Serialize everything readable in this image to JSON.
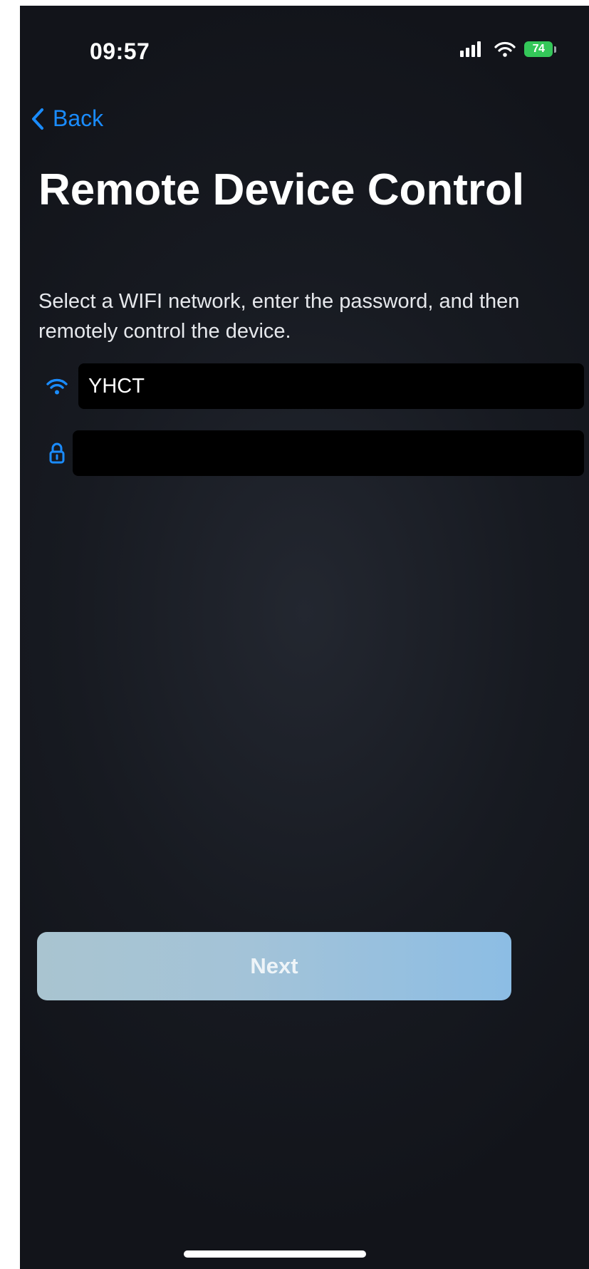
{
  "status_bar": {
    "time": "09:57",
    "battery_level": "74",
    "battery_color": "#34c759",
    "icons": [
      "cellular-signal-icon",
      "wifi-icon",
      "battery-icon"
    ]
  },
  "nav": {
    "back_label": "Back",
    "accent_color": "#1a8cff"
  },
  "page": {
    "title": "Remote Device Control",
    "description": "Select a WIFI network, enter the password, and then remotely control the device."
  },
  "form": {
    "ssid": {
      "icon": "wifi-icon",
      "value": "YHCT"
    },
    "password": {
      "icon": "lock-icon",
      "value": ""
    }
  },
  "actions": {
    "next_label": "Next"
  }
}
